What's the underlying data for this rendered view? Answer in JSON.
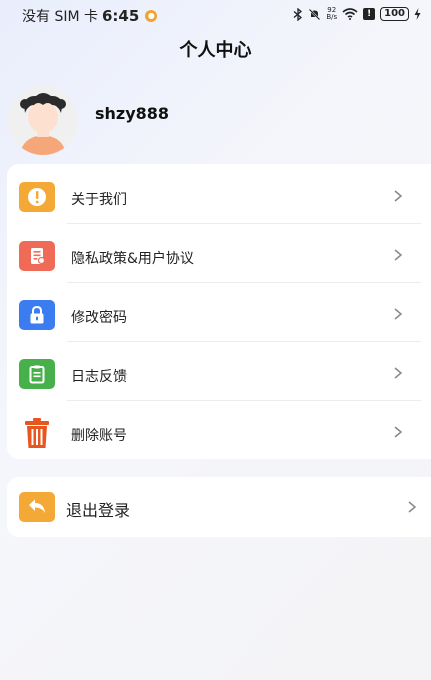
{
  "status_bar": {
    "carrier": "没有 SIM 卡",
    "time": "6:45",
    "net_speed_value": "92",
    "net_speed_unit": "B/s",
    "battery": "100"
  },
  "header": {
    "title": "个人中心"
  },
  "profile": {
    "username": "shzy888"
  },
  "menu": {
    "items": [
      {
        "label": "关于我们",
        "icon": "about-icon",
        "color": "#f4a836"
      },
      {
        "label": "隐私政策&用户协议",
        "icon": "privacy-document-icon",
        "color": "#ef6b57"
      },
      {
        "label": "修改密码",
        "icon": "lock-icon",
        "color": "#3b7cf0"
      },
      {
        "label": "日志反馈",
        "icon": "clipboard-icon",
        "color": "#47b04b"
      },
      {
        "label": "删除账号",
        "icon": "trash-icon",
        "color": "#e8561f"
      }
    ]
  },
  "logout": {
    "label": "退出登录",
    "icon": "back-arrow-icon",
    "color": "#f4a836"
  }
}
